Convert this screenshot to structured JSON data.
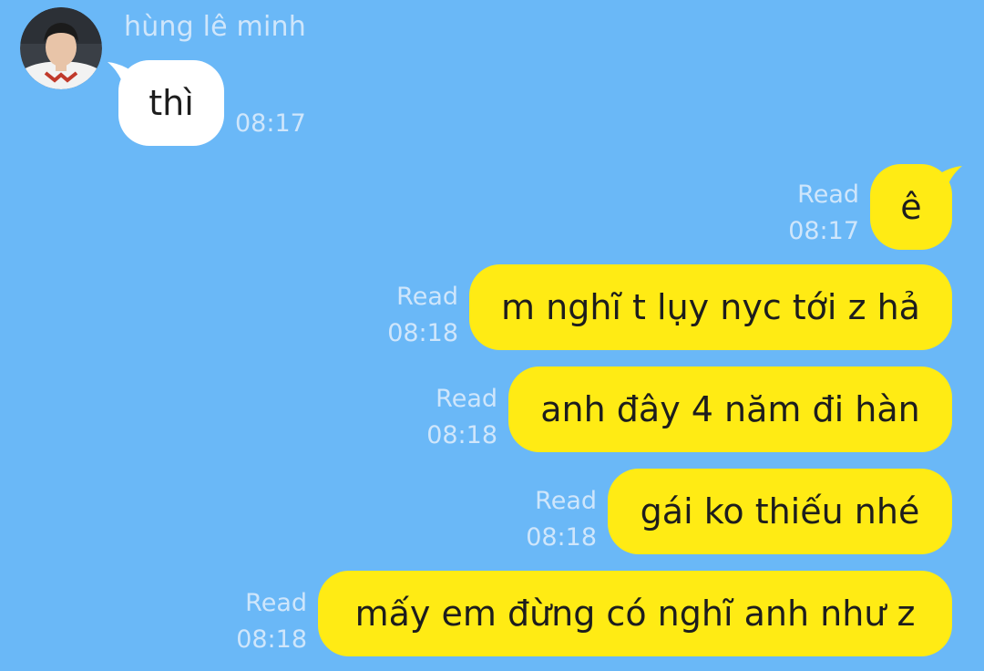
{
  "incoming": {
    "sender_name": "hùng lê minh",
    "avatar_icon": "user-avatar",
    "message": {
      "text": "thì",
      "time": "08:17"
    }
  },
  "outgoing": [
    {
      "text": "ê",
      "status": "Read",
      "time": "08:17"
    },
    {
      "text": "m nghĩ t lụy nyc tới z hả",
      "status": "Read",
      "time": "08:18"
    },
    {
      "text": "anh đây 4 năm đi hàn",
      "status": "Read",
      "time": "08:18"
    },
    {
      "text": "gái ko thiếu nhé",
      "status": "Read",
      "time": "08:18"
    },
    {
      "text": "mấy em đừng có nghĩ anh như z",
      "status": "Read",
      "time": "08:18"
    }
  ],
  "colors": {
    "background": "#6ab8f7",
    "incoming_bubble": "#ffffff",
    "outgoing_bubble": "#ffeb14",
    "meta_text": "#cfe6fb"
  }
}
